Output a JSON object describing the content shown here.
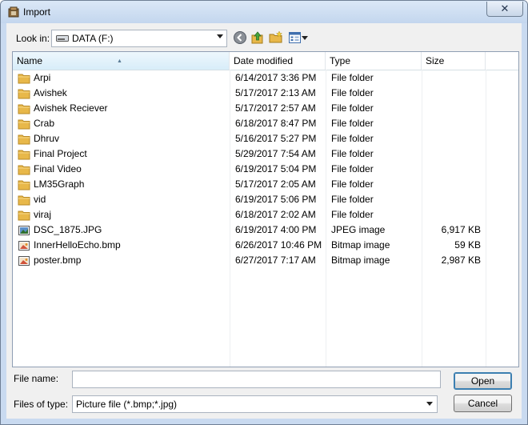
{
  "window": {
    "title": "Import",
    "close_glyph": "✕"
  },
  "toolbar": {
    "lookin_label": "Look in:",
    "lookin_value": "DATA (F:)",
    "icons": [
      "back-icon",
      "up-folder-icon",
      "new-folder-icon",
      "views-menu-icon"
    ]
  },
  "list": {
    "columns": {
      "name": "Name",
      "date": "Date modified",
      "type": "Type",
      "size": "Size"
    },
    "items": [
      {
        "name": "Arpi",
        "date": "6/14/2017 3:36 PM",
        "type": "File folder",
        "size": "",
        "icon": "folder-icon"
      },
      {
        "name": "Avishek",
        "date": "5/17/2017 2:13 AM",
        "type": "File folder",
        "size": "",
        "icon": "folder-icon"
      },
      {
        "name": "Avishek Reciever",
        "date": "5/17/2017 2:57 AM",
        "type": "File folder",
        "size": "",
        "icon": "folder-icon"
      },
      {
        "name": "Crab",
        "date": "6/18/2017 8:47 PM",
        "type": "File folder",
        "size": "",
        "icon": "folder-icon"
      },
      {
        "name": "Dhruv",
        "date": "5/16/2017 5:27 PM",
        "type": "File folder",
        "size": "",
        "icon": "folder-icon"
      },
      {
        "name": "Final Project",
        "date": "5/29/2017 7:54 AM",
        "type": "File folder",
        "size": "",
        "icon": "folder-icon"
      },
      {
        "name": "Final Video",
        "date": "6/19/2017 5:04 PM",
        "type": "File folder",
        "size": "",
        "icon": "folder-icon"
      },
      {
        "name": "LM35Graph",
        "date": "5/17/2017 2:05 AM",
        "type": "File folder",
        "size": "",
        "icon": "folder-icon"
      },
      {
        "name": "vid",
        "date": "6/19/2017 5:06 PM",
        "type": "File folder",
        "size": "",
        "icon": "folder-icon"
      },
      {
        "name": "viraj",
        "date": "6/18/2017 2:02 AM",
        "type": "File folder",
        "size": "",
        "icon": "folder-icon"
      },
      {
        "name": "DSC_1875.JPG",
        "date": "6/19/2017 4:00 PM",
        "type": "JPEG image",
        "size": "6,917 KB",
        "icon": "jpeg-image-icon"
      },
      {
        "name": "InnerHelloEcho.bmp",
        "date": "6/26/2017 10:46 PM",
        "type": "Bitmap image",
        "size": "59 KB",
        "icon": "bitmap-image-icon"
      },
      {
        "name": "poster.bmp",
        "date": "6/27/2017 7:17 AM",
        "type": "Bitmap image",
        "size": "2,987 KB",
        "icon": "bitmap-image-icon"
      }
    ]
  },
  "footer": {
    "filename_label": "File name:",
    "filename_value": "",
    "filetype_label": "Files of type:",
    "filetype_value": "Picture file (*.bmp;*.jpg)",
    "open_label": "Open",
    "cancel_label": "Cancel"
  },
  "colors": {
    "folder": "#e8b84a",
    "titlebar": "#c3d6ee",
    "header_active": "#d8edf9"
  }
}
